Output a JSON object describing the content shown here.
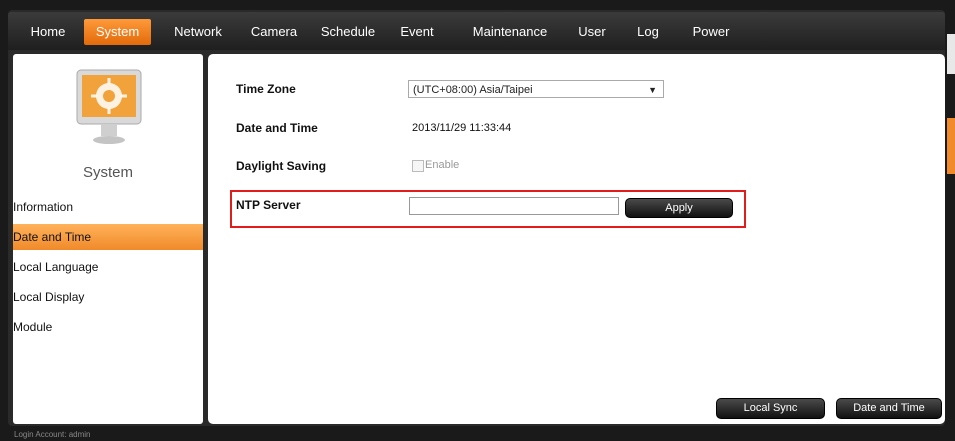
{
  "nav": {
    "items": [
      {
        "label": "Home"
      },
      {
        "label": "System"
      },
      {
        "label": "Network"
      },
      {
        "label": "Camera"
      },
      {
        "label": "Schedule"
      },
      {
        "label": "Event"
      },
      {
        "label": "Maintenance"
      },
      {
        "label": "User"
      },
      {
        "label": "Log"
      },
      {
        "label": "Power"
      }
    ],
    "active": "System",
    "accent": "#f08a2a"
  },
  "sidebar": {
    "title": "System",
    "icon": "monitor-gear-icon",
    "items": [
      {
        "label": "Information"
      },
      {
        "label": "Date and Time"
      },
      {
        "label": "Local Language"
      },
      {
        "label": "Local Display"
      },
      {
        "label": "Module"
      }
    ],
    "active": "Date and Time"
  },
  "form": {
    "time_zone_label": "Time Zone",
    "time_zone_value": "(UTC+08:00) Asia/Taipei",
    "date_time_label": "Date and Time",
    "date_time_value": "2013/11/29 11:33:44",
    "daylight_label": "Daylight Saving",
    "daylight_checkbox_label": "Enable",
    "ntp_label": "NTP Server",
    "ntp_value": "",
    "apply_label": "Apply",
    "highlight_color": "#e21c1c"
  },
  "footer": {
    "local_sync_label": "Local Sync",
    "date_time_button_label": "Date and Time",
    "login_account": "Login Account: admin"
  }
}
